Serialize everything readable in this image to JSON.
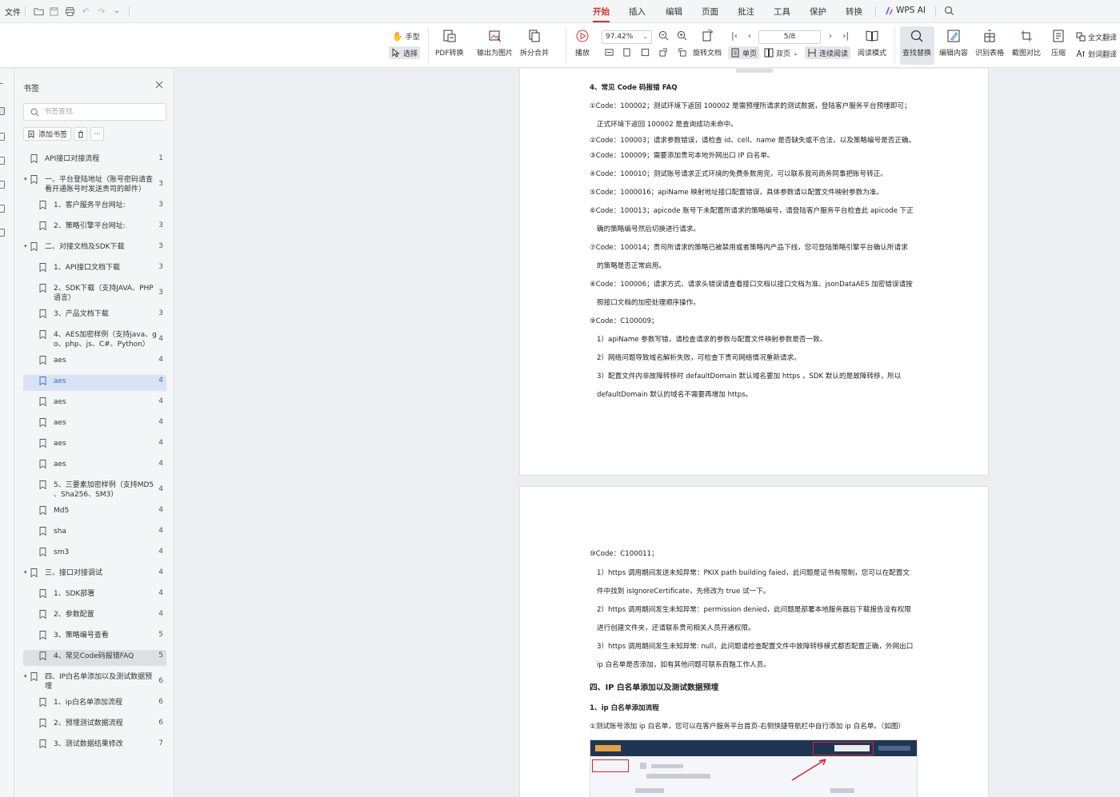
{
  "topbar": {
    "file_label": "文件",
    "tabs": [
      "开始",
      "插入",
      "编辑",
      "页面",
      "批注",
      "工具",
      "保护",
      "转换"
    ],
    "active_tab": "开始",
    "ai_label": "WPS AI"
  },
  "ribbon": {
    "hand_tool": "手型",
    "select_tool": "选择",
    "pdf_convert": "PDF转换",
    "export_image": "输出为图片",
    "split_merge": "拆分合并",
    "play": "播放",
    "zoom_value": "97.42%",
    "page_value": "5/8",
    "rotate_doc": "旋转文档",
    "single_page": "单页",
    "double_page": "双页",
    "continuous": "连续阅读",
    "read_mode": "阅读模式",
    "find_replace": "查找替换",
    "edit_content": "编辑内容",
    "recognize_table": "识别表格",
    "screenshot_compare": "截图对比",
    "compress": "压缩",
    "full_translate": "全文翻译",
    "word_translate": "划词翻译"
  },
  "sidebar": {
    "title": "书签",
    "search_placeholder": "书签查找",
    "add_bookmark": "添加书签",
    "more": "···",
    "items": [
      {
        "label": "API接口对接流程",
        "page": "1",
        "level": 0,
        "arrow": ""
      },
      {
        "label": "一、平台登陆地址（账号密码请查",
        "label2": "看开通账号时发送责司的邮件）",
        "page": "3",
        "level": 0,
        "arrow": "▾"
      },
      {
        "label": "1、客户服务平台网址:",
        "page": "3",
        "level": 1,
        "arrow": ""
      },
      {
        "label": "2、策略引擎平台网址:",
        "page": "3",
        "level": 1,
        "arrow": ""
      },
      {
        "label": "二、对接文档及SDK下载",
        "page": "3",
        "level": 0,
        "arrow": "▾"
      },
      {
        "label": "1、API接口文档下载",
        "page": "3",
        "level": 1,
        "arrow": ""
      },
      {
        "label": "2、SDK下载（支持JAVA、PHP",
        "label2": "语言）",
        "page": "3",
        "level": 1,
        "arrow": ""
      },
      {
        "label": "3、产品文档下载",
        "page": "3",
        "level": 1,
        "arrow": ""
      },
      {
        "label": "4、AES加密样例（支持java、g",
        "label2": "o、php、js、C#、Python）",
        "page": "4",
        "level": 1,
        "arrow": ""
      },
      {
        "label": "aes",
        "page": "4",
        "level": 1,
        "arrow": ""
      },
      {
        "label": "aes",
        "page": "4",
        "level": 1,
        "arrow": "",
        "selected": "blue"
      },
      {
        "label": "aes",
        "page": "4",
        "level": 1,
        "arrow": ""
      },
      {
        "label": "aes",
        "page": "4",
        "level": 1,
        "arrow": ""
      },
      {
        "label": "aes",
        "page": "4",
        "level": 1,
        "arrow": ""
      },
      {
        "label": "aes",
        "page": "4",
        "level": 1,
        "arrow": ""
      },
      {
        "label": "5、三要素加密样例（支持MD5",
        "label2": "、Sha256、SM3）",
        "page": "4",
        "level": 1,
        "arrow": ""
      },
      {
        "label": "Md5",
        "page": "4",
        "level": 1,
        "arrow": ""
      },
      {
        "label": "sha",
        "page": "4",
        "level": 1,
        "arrow": ""
      },
      {
        "label": "sm3",
        "page": "4",
        "level": 1,
        "arrow": ""
      },
      {
        "label": "三、接口对接调试",
        "page": "4",
        "level": 0,
        "arrow": "▾"
      },
      {
        "label": "1、SDK部署",
        "page": "4",
        "level": 1,
        "arrow": ""
      },
      {
        "label": "2、参数配置",
        "page": "4",
        "level": 1,
        "arrow": ""
      },
      {
        "label": "3、策略编号查看",
        "page": "5",
        "level": 1,
        "arrow": ""
      },
      {
        "label": "4、常见Code码报错FAQ",
        "page": "5",
        "level": 1,
        "arrow": "",
        "selected": "gray"
      },
      {
        "label": "四、IP白名单添加以及测试数据预",
        "label2": "埋",
        "page": "6",
        "level": 0,
        "arrow": "▾"
      },
      {
        "label": "1、ip白名单添加流程",
        "page": "6",
        "level": 1,
        "arrow": ""
      },
      {
        "label": "2、预埋测试数据流程",
        "page": "6",
        "level": 1,
        "arrow": ""
      },
      {
        "label": "3、测试数据结果修改",
        "page": "7",
        "level": 1,
        "arrow": ""
      }
    ]
  },
  "doc": {
    "page1": [
      {
        "t": "4、常见 Code 码报错 FAQ",
        "cls": "h"
      },
      {
        "t": "①Code：100002；测试环境下返回 100002 是需预埋所请求的测试数据，登陆客户服务平台预埋即可；",
        "cls": ""
      },
      {
        "t": "正式环境下返回 100002 是查询成功未命中。",
        "cls": "ind"
      },
      {
        "t": "②Code：100003；请求参数错误，请检查 id、cell、name 是否缺失或不合法，以及策略编号是否正确。",
        "cls": ""
      },
      {
        "t": "③Code：100009；需要添加贵司本地外网出口 IP 白名单。",
        "cls": ""
      },
      {
        "t": "④Code：100010；测试账号请求正式环境的免费条数用完，可以联系我司商务同事把账号转正。",
        "cls": ""
      },
      {
        "t": "⑤Code：1000016；apiName 映射地址接口配置错误，具体参数请以配置文件映射参数为准。",
        "cls": ""
      },
      {
        "t": "⑥Code：100013；apicode 账号下未配置所请求的策略编号，请登陆客户服务平台检查此 apicode 下正",
        "cls": ""
      },
      {
        "t": "确的策略编号然后切换进行请求。",
        "cls": "ind"
      },
      {
        "t": "⑦Code：100014；贵司所请求的策略已被禁用或者策略内产品下线，您可登陆策略引擎平台确认所请求",
        "cls": ""
      },
      {
        "t": "的策略是否正常启用。",
        "cls": "ind"
      },
      {
        "t": "⑧Code：100006；请求方式、请求头错误请查看接口文档以接口文档为准、jsonDataAES 加密错误请按",
        "cls": ""
      },
      {
        "t": "照接口文档的加密处理顺序操作。",
        "cls": "ind"
      },
      {
        "t": "⑨Code：C100009；",
        "cls": ""
      },
      {
        "t": "1）apiName 参数写错，请检查请求的参数与配置文件映射参数是否一致。",
        "cls": "ind"
      },
      {
        "t": "2）网络问题导致域名解析失败，可检查下贵司网络情况重新请求。",
        "cls": "ind"
      },
      {
        "t": "3）配置文件内非故障转移时 defaultDomain 默认域名要加 https ，SDK 默认的是故障转移，所以",
        "cls": "ind"
      },
      {
        "t": "defaultDomain 默认的域名不需要再增加 https。",
        "cls": "ind"
      }
    ],
    "page2": [
      {
        "t": "⑩Code：C100011；",
        "cls": ""
      },
      {
        "t": "1）https 调用期间发送未知异常：PKIX path building faied，此问题是证书有限制，您可以在配置文",
        "cls": "ind"
      },
      {
        "t": "件中找到 isIgnoreCertificate，先修改为 true 试一下。",
        "cls": "ind"
      },
      {
        "t": "2）https 调用期间发生未知异常：permission denied，此问题是部署本地服务器后下载报告没有权限",
        "cls": "ind"
      },
      {
        "t": "进行创建文件夹，还请联系贵司相关人员开通权限。",
        "cls": "ind"
      },
      {
        "t": "3）https 调用期间发生未知异常: null，此问题请检查配置文件中故障转移模式都否配置正确，外网出口",
        "cls": "ind"
      },
      {
        "t": "ip 白名单是否添加，如有其他问题可联系百融工作人员。",
        "cls": "ind"
      },
      {
        "t": "四、IP 白名单添加以及测试数据预埋",
        "cls": "h2"
      },
      {
        "t": "1、ip 白名单添加流程",
        "cls": "h"
      },
      {
        "t": "①测试账号添加 ip 白名单，您可以在客户服务平台首页-右侧快捷导航栏中自行添加 ip 白名单。（如图）",
        "cls": ""
      }
    ]
  },
  "colors": {
    "accent": "#d0342c",
    "select_blue": "#2f6fd1"
  }
}
